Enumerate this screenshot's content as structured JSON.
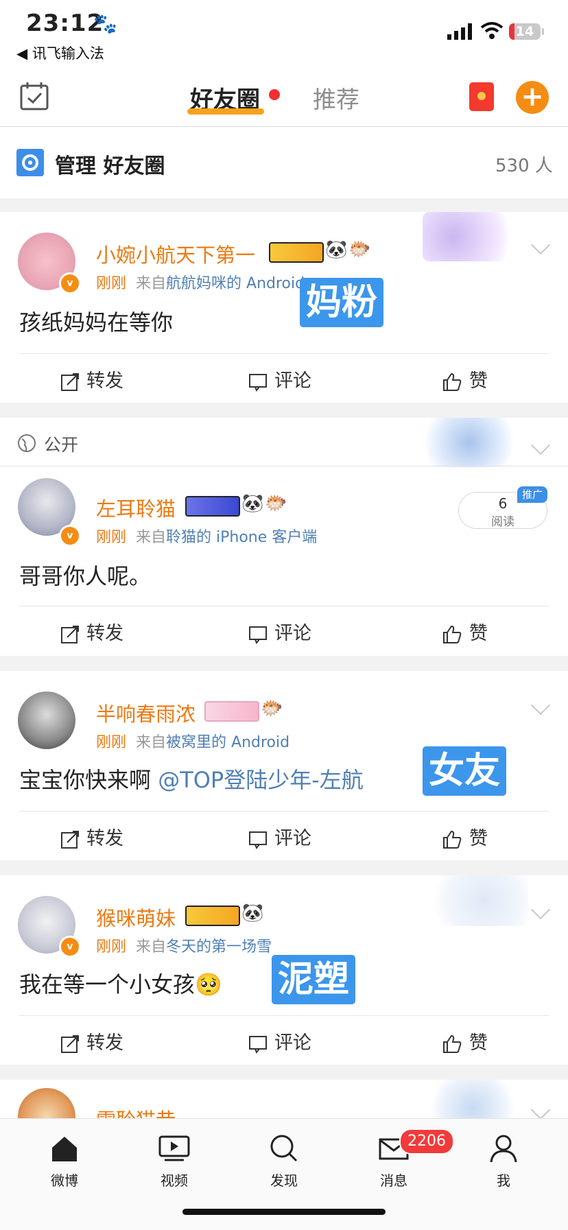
{
  "status": {
    "time": "23:12",
    "paw": "🐾",
    "back_app": "◀ 讯飞输入法",
    "battery": "14"
  },
  "header": {
    "tab_active": "好友圈",
    "tab_inactive": "推荐"
  },
  "manage": {
    "label": "管理  好友圈",
    "count": "530 人"
  },
  "common": {
    "repost": "转发",
    "comment": "评论",
    "like": "赞",
    "just_now": "刚刚",
    "from": "来自",
    "public": "公开",
    "read_label": "阅读",
    "promo": "推广"
  },
  "posts": [
    {
      "name": "小婉小航天下第一",
      "source": "航航妈咪的 Android",
      "text": "孩纸妈妈在等你",
      "overlay": "妈粉"
    },
    {
      "name": "左耳聆猫",
      "source": "聆猫的 iPhone 客户端",
      "text": "哥哥你人呢。",
      "reads": "6"
    },
    {
      "name": "半响春雨浓",
      "source": "被窝里的 Android",
      "text": "宝宝你快来啊 ",
      "mention": "@TOP登陆少年-左航",
      "overlay": "女友"
    },
    {
      "name": "猴咪萌妹",
      "source": "冬天的第一场雪",
      "text": "我在等一个小女孩",
      "emoji": "🥺",
      "overlay": "泥塑"
    },
    {
      "name": "雪聆猫巷"
    }
  ],
  "tabs": [
    "微博",
    "视频",
    "发现",
    "消息",
    "我"
  ],
  "message_badge": "2206",
  "colors": {
    "accent": "#f68c12",
    "link": "#4f7fb4",
    "overlay": "#3c96ec",
    "badge": "#f23a3a"
  }
}
